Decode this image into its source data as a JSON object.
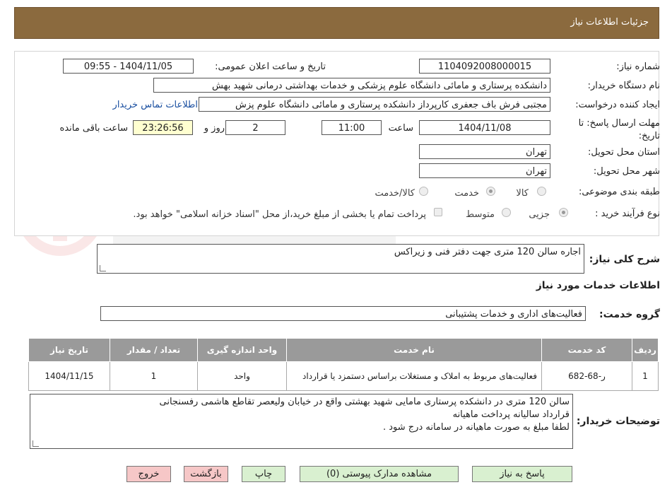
{
  "header": {
    "title": "جزئیات اطلاعات نیاز"
  },
  "form": {
    "need_number_label": "شماره نیاز:",
    "need_number": "1104092008000015",
    "announce_label": "تاریخ و ساعت اعلان عمومی:",
    "announce_value": "1404/11/05 - 09:55",
    "buyer_org_label": "نام دستگاه خریدار:",
    "buyer_org": "دانشکده پرستاری و مامائی دانشگاه علوم پزشکی و خدمات بهداشتی درمانی شهید بهش",
    "requester_label": "ایجاد کننده درخواست:",
    "requester": "مجتبی فرش باف جعفری کارپرداز دانشکده پرستاری و مامائی دانشگاه علوم پزش",
    "contact_link": "اطلاعات تماس خریدار",
    "deadline_label": "مهلت ارسال پاسخ: تا تاریخ:",
    "deadline_date": "1404/11/08",
    "time_label": "ساعت",
    "deadline_time": "11:00",
    "days_value": "2",
    "days_label": "روز و",
    "remaining_time": "23:26:56",
    "remaining_label": "ساعت باقی مانده",
    "province_label": "استان محل تحویل:",
    "province": "تهران",
    "city_label": "شهر محل تحویل:",
    "city": "تهران",
    "category_label": "طبقه بندی موضوعی:",
    "category_options": [
      "کالا",
      "خدمت",
      "کالا/خدمت"
    ],
    "purchase_type_label": "نوع فرآیند خرید :",
    "purchase_type_options": [
      "جزیی",
      "متوسط"
    ],
    "payment_note": "پرداخت تمام یا بخشی از مبلغ خرید،از محل \"اسناد خزانه اسلامی\" خواهد بود."
  },
  "summary": {
    "label": "شرح کلی نیاز:",
    "value": "اجاره سالن 120 متری جهت دفتر فنی و زیراکس"
  },
  "services_title": "اطلاعات خدمات مورد نیاز",
  "service_group": {
    "label": "گروه خدمت:",
    "value": "فعالیت‌های اداری و خدمات پشتیبانی"
  },
  "table": {
    "headers": [
      "ردیف",
      "کد خدمت",
      "نام خدمت",
      "واحد اندازه گیری",
      "تعداد / مقدار",
      "تاریخ نیاز"
    ],
    "rows": [
      {
        "row": "1",
        "code": "ر-68-682",
        "name": "فعالیت‌های مربوط به املاک و مستغلات براساس دستمزد یا قرارداد",
        "unit": "واحد",
        "qty": "1",
        "date": "1404/11/15"
      }
    ]
  },
  "buyer_notes": {
    "label": "توضیحات خریدار:",
    "lines": [
      "سالن 120 متری در دانشکده پرستاری مامایی شهید بهشتی واقع در خیابان ولیعصر تقاطع هاشمی رفسنجانی",
      "قرارداد سالیانه پرداخت ماهیانه",
      "لطفا مبلغ به صورت ماهیانه در سامانه درج شود ."
    ]
  },
  "buttons": {
    "reply": "پاسخ به نیاز",
    "attachments": "مشاهده مدارک پیوستی (0)",
    "print": "چاپ",
    "back": "بازگشت",
    "exit": "خروج"
  },
  "colors": {
    "header_bg": "#8b6a3e",
    "table_header_bg": "#9a9a9a",
    "green_button": "#d9f0d0",
    "red_button": "#f6c7c7",
    "timer_bg": "#ffffd0"
  }
}
